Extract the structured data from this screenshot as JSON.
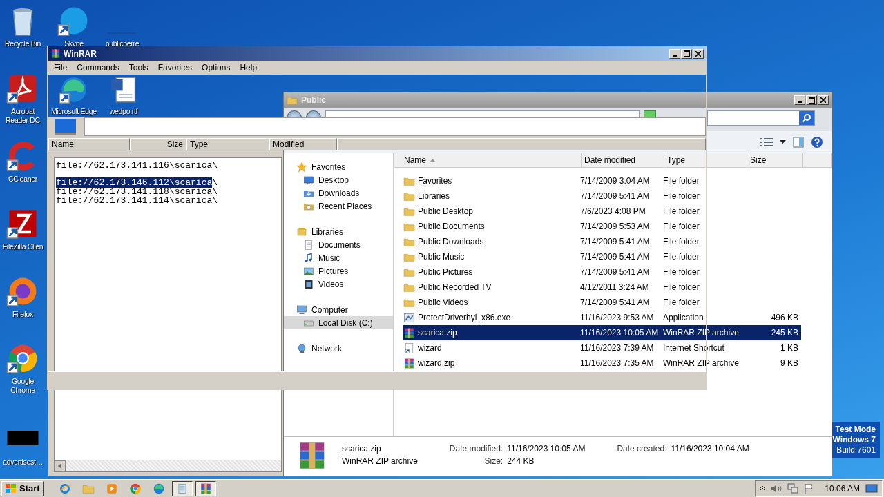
{
  "desktop": {
    "icons": [
      {
        "label": "Recycle Bin",
        "kind": "recycle-bin"
      },
      {
        "label": "Skype",
        "kind": "skype"
      },
      {
        "label": "publicberre",
        "kind": "blank"
      },
      {
        "label": "Acrobat Reader DC",
        "kind": "acrobat"
      },
      {
        "label": "CCleaner",
        "kind": "ccleaner"
      },
      {
        "label": "FileZilla Clien",
        "kind": "filezilla"
      },
      {
        "label": "Firefox",
        "kind": "firefox"
      },
      {
        "label": "Google Chrome",
        "kind": "chrome"
      },
      {
        "label": "advertisest…",
        "kind": "thumbnail"
      },
      {
        "label": "Microsoft Edge",
        "kind": "edge"
      },
      {
        "label": "wedpo.rtf",
        "kind": "word"
      }
    ],
    "system_notice": [
      "Test Mode",
      "Windows 7",
      "Build 7601"
    ]
  },
  "winrar": {
    "title": "WinRAR",
    "menu": [
      "File",
      "Commands",
      "Tools",
      "Favorites",
      "Options",
      "Help"
    ],
    "columns": [
      "Name",
      "Size",
      "Type",
      "Modified"
    ]
  },
  "notepad": {
    "lines": [
      {
        "kind": "text",
        "segments": [
          {
            "text": "file://62.173.141.116\\scarica\\",
            "selected": false
          }
        ]
      },
      {
        "kind": "blank"
      },
      {
        "kind": "text",
        "segments": [
          {
            "text": "file://62.173.146.112\\scarica",
            "selected": true
          },
          {
            "text": "\\",
            "selected": false
          }
        ]
      },
      {
        "kind": "text",
        "segments": [
          {
            "text": "file://62.173.141.118\\scarica\\",
            "selected": false
          }
        ]
      },
      {
        "kind": "text",
        "segments": [
          {
            "text": "file://62.173.141.114\\scarica\\",
            "selected": false
          }
        ]
      }
    ]
  },
  "explorer": {
    "title": "Public",
    "nav": [
      {
        "label": "Favorites",
        "kind": "star",
        "selected": false,
        "children": [
          {
            "label": "Desktop",
            "kind": "desktop",
            "selected": false
          },
          {
            "label": "Downloads",
            "kind": "downloads",
            "selected": false
          },
          {
            "label": "Recent Places",
            "kind": "recent",
            "selected": false
          }
        ]
      },
      {
        "label": "Libraries",
        "kind": "library",
        "selected": false,
        "children": [
          {
            "label": "Documents",
            "kind": "documents",
            "selected": false
          },
          {
            "label": "Music",
            "kind": "music",
            "selected": false
          },
          {
            "label": "Pictures",
            "kind": "pictures",
            "selected": false
          },
          {
            "label": "Videos",
            "kind": "videos",
            "selected": false
          }
        ]
      },
      {
        "label": "Computer",
        "kind": "computer",
        "selected": false,
        "children": [
          {
            "label": "Local Disk (C:)",
            "kind": "disk",
            "selected": true
          }
        ]
      },
      {
        "label": "Network",
        "kind": "network",
        "selected": false
      }
    ],
    "columns": [
      "Name",
      "Date modified",
      "Type",
      "Size"
    ],
    "files": [
      {
        "name": "Favorites",
        "date": "7/14/2009 3:04 AM",
        "type": "File folder",
        "kind": "folder",
        "selected": false
      },
      {
        "name": "Libraries",
        "date": "7/14/2009 5:41 AM",
        "type": "File folder",
        "kind": "folder",
        "selected": false
      },
      {
        "name": "Public Desktop",
        "date": "7/6/2023 4:08 PM",
        "type": "File folder",
        "kind": "folder",
        "selected": false
      },
      {
        "name": "Public Documents",
        "date": "7/14/2009 5:53 AM",
        "type": "File folder",
        "kind": "folder",
        "selected": false
      },
      {
        "name": "Public Downloads",
        "date": "7/14/2009 5:41 AM",
        "type": "File folder",
        "kind": "folder",
        "selected": false
      },
      {
        "name": "Public Music",
        "date": "7/14/2009 5:41 AM",
        "type": "File folder",
        "kind": "folder",
        "selected": false
      },
      {
        "name": "Public Pictures",
        "date": "7/14/2009 5:41 AM",
        "type": "File folder",
        "kind": "folder",
        "selected": false
      },
      {
        "name": "Public Recorded TV",
        "date": "4/12/2011 3:24 AM",
        "type": "File folder",
        "kind": "folder",
        "selected": false
      },
      {
        "name": "Public Videos",
        "date": "7/14/2009 5:41 AM",
        "type": "File folder",
        "kind": "folder",
        "selected": false
      },
      {
        "name": "ProtectDriverhyl_x86.exe",
        "date": "11/16/2023 9:53 AM",
        "type": "Application",
        "size": "496 KB",
        "kind": "exe",
        "selected": false
      },
      {
        "name": "scarica.zip",
        "date": "11/16/2023 10:05 AM",
        "type": "WinRAR ZIP archive",
        "size": "245 KB",
        "kind": "zip",
        "selected": true
      },
      {
        "name": "wizard",
        "date": "11/16/2023 7:39 AM",
        "type": "Internet Shortcut",
        "size": "1 KB",
        "kind": "shortcut",
        "selected": false
      },
      {
        "name": "wizard.zip",
        "date": "11/16/2023 7:35 AM",
        "type": "WinRAR ZIP archive",
        "size": "9 KB",
        "kind": "zip",
        "selected": false
      }
    ],
    "details": {
      "name": "scarica.zip",
      "type": "WinRAR ZIP archive",
      "fields": [
        {
          "label": "Date modified:",
          "value": "11/16/2023 10:05 AM"
        },
        {
          "label": "Size:",
          "value": "244 KB"
        },
        {
          "label": "Date created:",
          "value": "11/16/2023 10:04 AM"
        }
      ]
    }
  },
  "taskbar": {
    "start": "Start",
    "apps": [
      {
        "kind": "ie",
        "pressed": false
      },
      {
        "kind": "folder",
        "pressed": false
      },
      {
        "kind": "media",
        "pressed": false
      },
      {
        "kind": "chrome",
        "pressed": false
      },
      {
        "kind": "edge",
        "pressed": false
      },
      {
        "kind": "notepad",
        "pressed": true
      },
      {
        "kind": "zip",
        "pressed": true
      }
    ],
    "clock": "10:06 AM"
  }
}
